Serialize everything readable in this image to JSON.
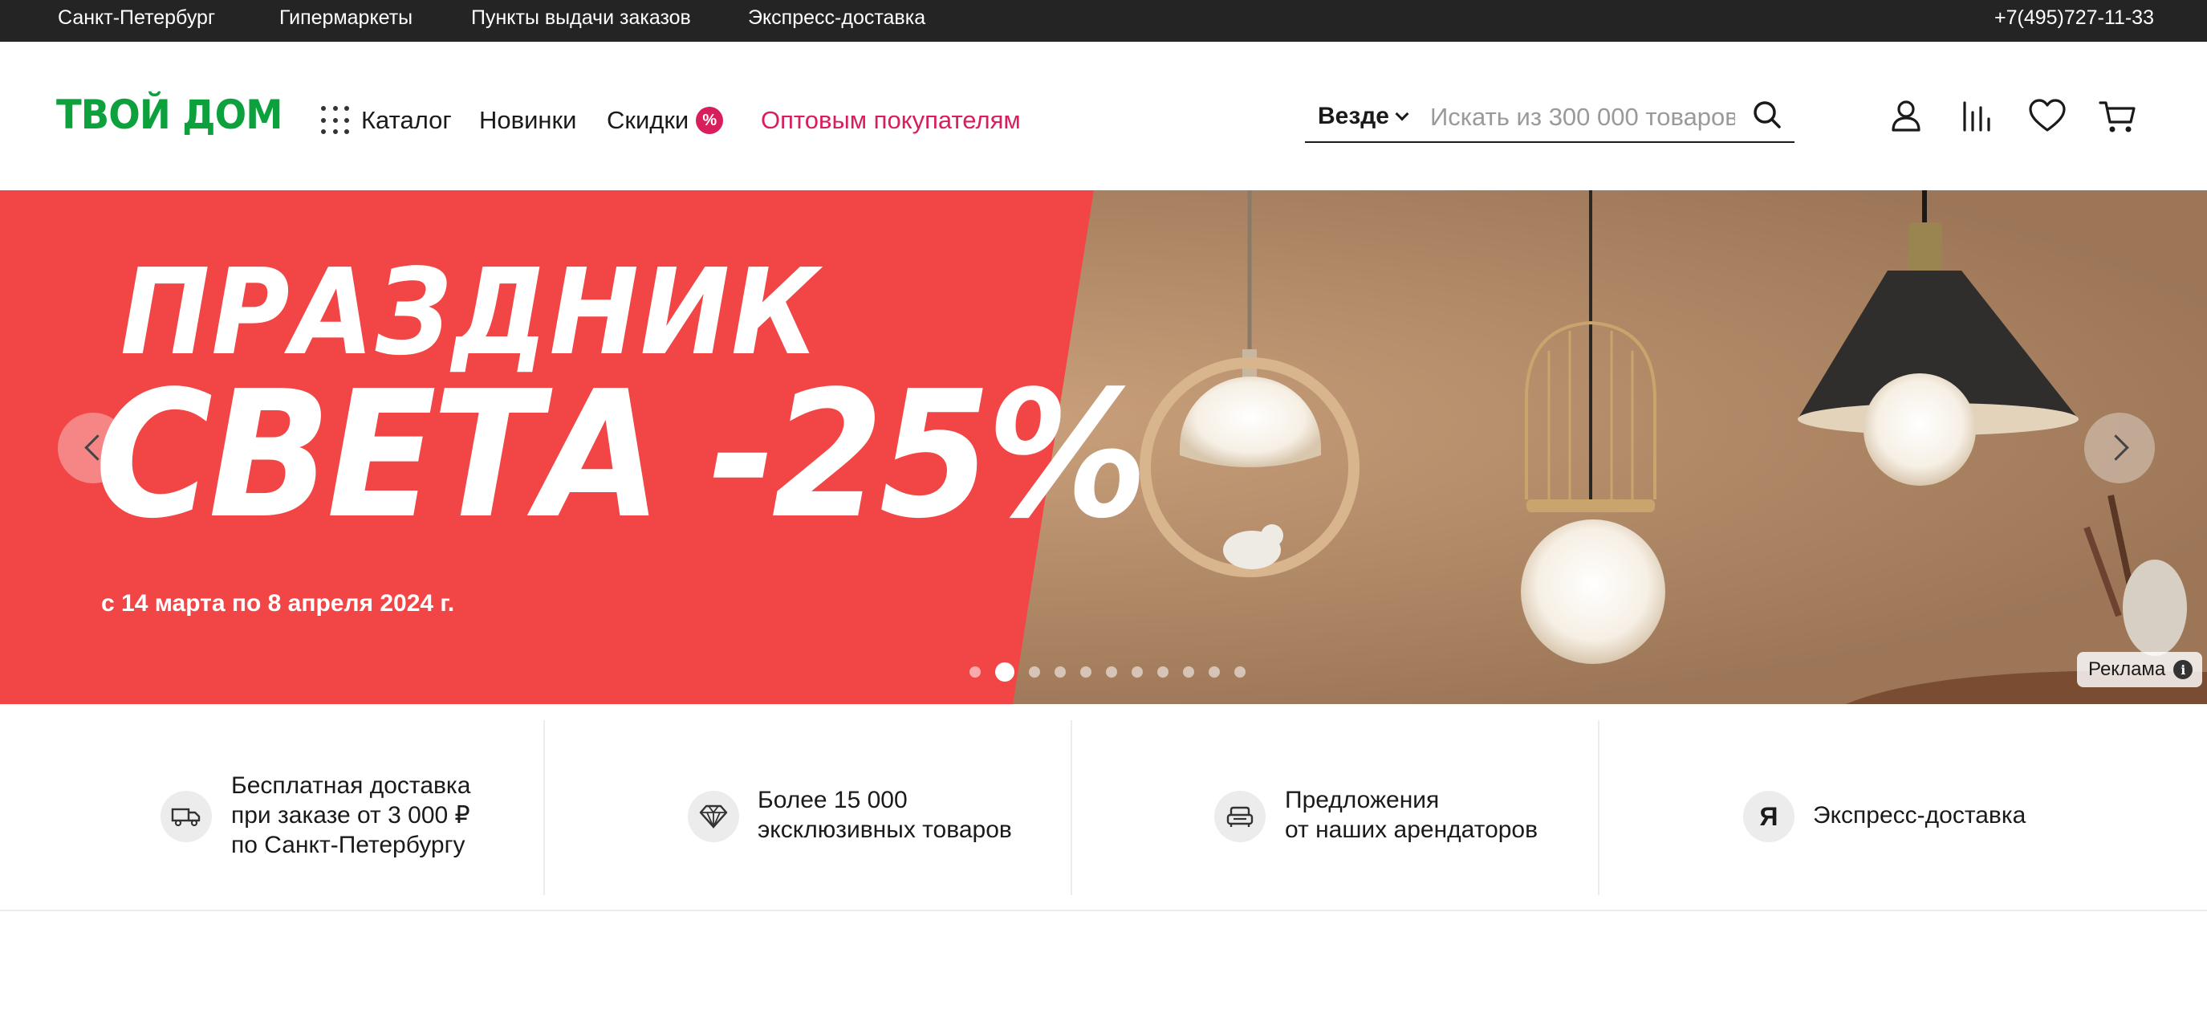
{
  "topbar": {
    "city": "Санкт-Петербург",
    "hypermarkets": "Гипермаркеты",
    "pickup_points": "Пункты выдачи заказов",
    "express": "Экспресс-доставка",
    "phone": "+7(495)727-11-33"
  },
  "header": {
    "logo": "ТВОЙ ДОМ",
    "nav": {
      "catalog": "Каталог",
      "new": "Новинки",
      "sale": "Скидки",
      "sale_badge": "%",
      "wholesale": "Оптовым покупателям"
    },
    "search": {
      "scope": "Везде",
      "placeholder": "Искать из 300 000 товаров"
    },
    "icons": [
      "user-icon",
      "compare-icon",
      "heart-icon",
      "cart-icon"
    ]
  },
  "banner": {
    "title_line1": "ПРАЗДНИК",
    "title_line2": "СВЕТА -25%",
    "dates": "с 14 марта по 8 апреля 2024 г.",
    "ad_label": "Реклама",
    "ad_info": "i",
    "slide_count": 11,
    "active_slide": 2,
    "colors": {
      "red": "#f24646",
      "photo": "#a98361"
    }
  },
  "features": [
    {
      "icon": "truck-icon",
      "lines": [
        "Бесплатная доставка",
        "при заказе от 3 000 ₽",
        "по Санкт-Петербургу"
      ]
    },
    {
      "icon": "diamond-icon",
      "lines": [
        "Более 15 000",
        "эксклюзивных товаров"
      ]
    },
    {
      "icon": "sofa-icon",
      "lines": [
        "Предложения",
        "от наших арендаторов"
      ]
    },
    {
      "icon": "yandex-icon",
      "glyph": "Я",
      "lines": [
        "Экспресс-доставка"
      ]
    }
  ],
  "colors": {
    "brand_green": "#0ca13d",
    "accent_pink": "#d81e5b",
    "topbar_bg": "#242424"
  }
}
